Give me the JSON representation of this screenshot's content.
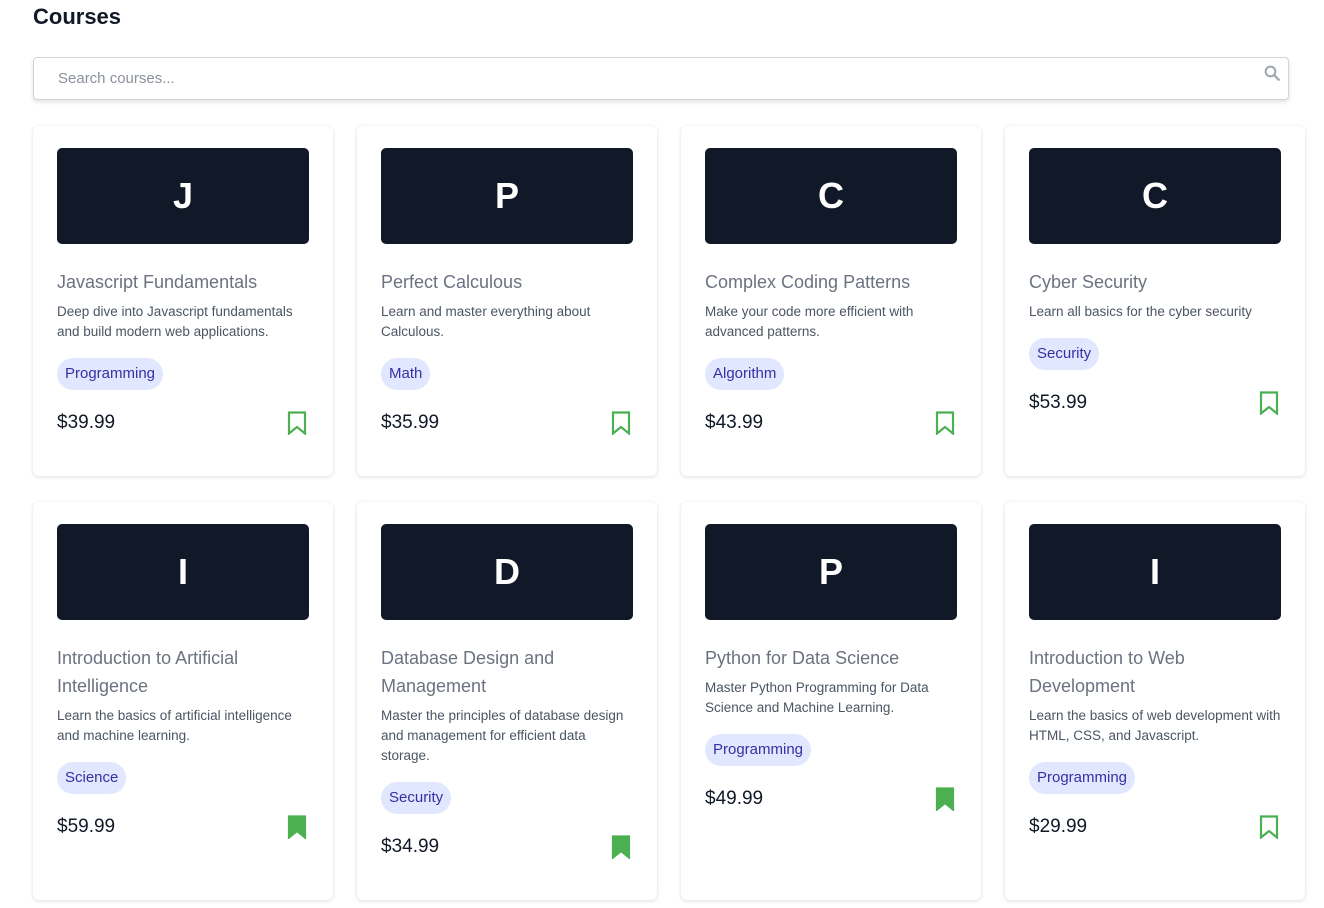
{
  "page": {
    "title": "Courses"
  },
  "search": {
    "placeholder": "Search courses..."
  },
  "colors": {
    "thumb_bg": "#111827",
    "tag_bg": "#e0e7ff",
    "tag_text": "#3730a3",
    "bookmark": "#4caf50"
  },
  "courses": [
    {
      "initial": "J",
      "title": "Javascript Fundamentals",
      "description": "Deep dive into Javascript fundamentals and build modern web applications.",
      "tag": "Programming",
      "price": "$39.99",
      "bookmarked": false,
      "bookmark_icon": "bookmark-outline-icon"
    },
    {
      "initial": "P",
      "title": "Perfect Calculous",
      "description": "Learn and master everything about Calculous.",
      "tag": "Math",
      "price": "$35.99",
      "bookmarked": false,
      "bookmark_icon": "bookmark-outline-icon"
    },
    {
      "initial": "C",
      "title": "Complex Coding Patterns",
      "description": "Make your code more efficient with advanced patterns.",
      "tag": "Algorithm",
      "price": "$43.99",
      "bookmarked": false,
      "bookmark_icon": "bookmark-outline-icon"
    },
    {
      "initial": "C",
      "title": "Cyber Security",
      "description": "Learn all basics for the cyber security",
      "tag": "Security",
      "price": "$53.99",
      "bookmarked": false,
      "bookmark_icon": "bookmark-outline-icon"
    },
    {
      "initial": "I",
      "title": "Introduction to Artificial Intelligence",
      "description": "Learn the basics of artificial intelligence and machine learning.",
      "tag": "Science",
      "price": "$59.99",
      "bookmarked": true,
      "bookmark_icon": "bookmark-filled-icon"
    },
    {
      "initial": "D",
      "title": "Database Design and Management",
      "description": "Master the principles of database design and management for efficient data storage.",
      "tag": "Security",
      "price": "$34.99",
      "bookmarked": true,
      "bookmark_icon": "bookmark-filled-icon"
    },
    {
      "initial": "P",
      "title": "Python for Data Science",
      "description": "Master Python Programming for Data Science and Machine Learning.",
      "tag": "Programming",
      "price": "$49.99",
      "bookmarked": true,
      "bookmark_icon": "bookmark-filled-icon"
    },
    {
      "initial": "I",
      "title": "Introduction to Web Development",
      "description": "Learn the basics of web development with HTML, CSS, and Javascript.",
      "tag": "Programming",
      "price": "$29.99",
      "bookmarked": false,
      "bookmark_icon": "bookmark-outline-icon"
    }
  ]
}
